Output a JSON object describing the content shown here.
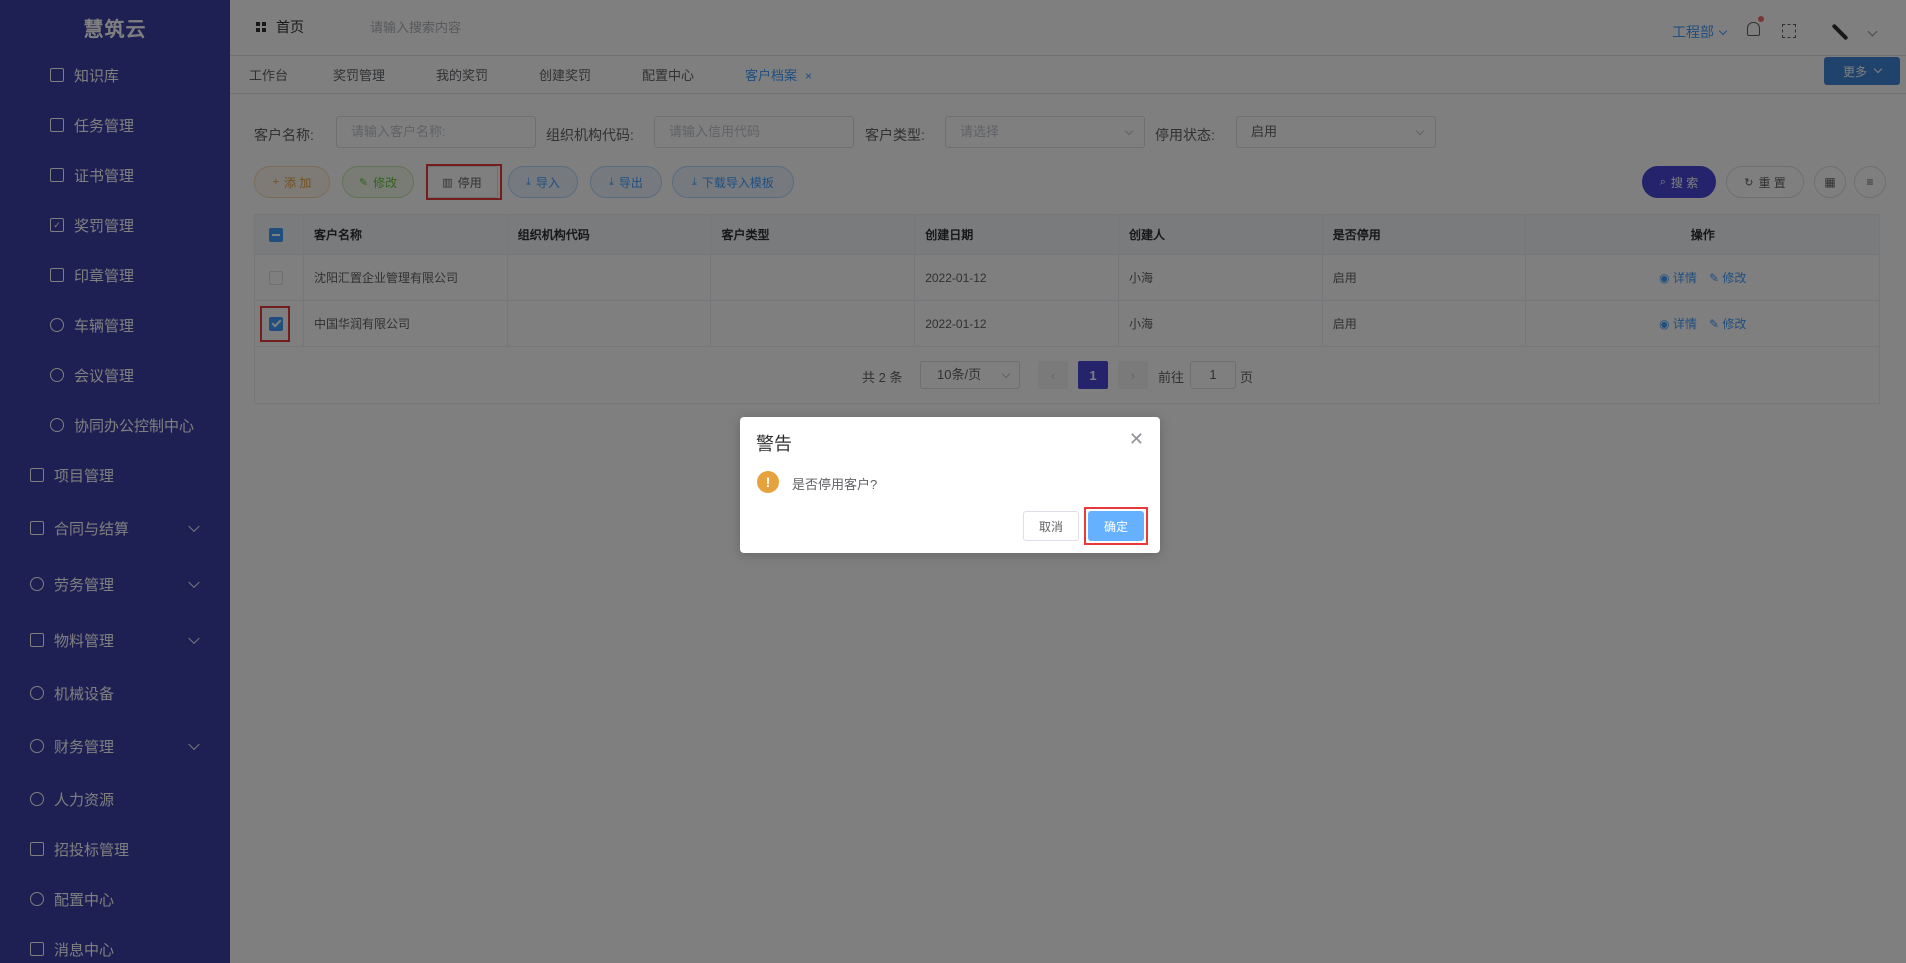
{
  "app": {
    "name": "慧筑云"
  },
  "sidebar": {
    "items": [
      {
        "label": "知识库",
        "icon": "book-icon"
      },
      {
        "label": "任务管理",
        "icon": "org-chart-icon"
      },
      {
        "label": "证书管理",
        "icon": "certificate-icon"
      },
      {
        "label": "奖罚管理",
        "icon": "checkbox-icon"
      },
      {
        "label": "印章管理",
        "icon": "grid-icon"
      },
      {
        "label": "车辆管理",
        "icon": "location-icon"
      },
      {
        "label": "会议管理",
        "icon": "phone-icon"
      },
      {
        "label": "协同办公控制中心",
        "icon": "gear-icon"
      },
      {
        "label": "项目管理",
        "icon": "book-icon"
      },
      {
        "label": "合同与结算",
        "icon": "edit-icon"
      },
      {
        "label": "劳务管理",
        "icon": "user-icon"
      },
      {
        "label": "物料管理",
        "icon": "edit-icon"
      },
      {
        "label": "机械设备",
        "icon": "close-circle-icon"
      },
      {
        "label": "财务管理",
        "icon": "phone-icon"
      },
      {
        "label": "人力资源",
        "icon": "phone-icon"
      },
      {
        "label": "招投标管理",
        "icon": "link-icon"
      },
      {
        "label": "配置中心",
        "icon": "gear-icon"
      },
      {
        "label": "消息中心",
        "icon": "message-icon"
      }
    ]
  },
  "topbar": {
    "home": "首页",
    "search_placeholder": "请输入搜索内容",
    "department": "工程部"
  },
  "tabs": {
    "items": [
      "工作台",
      "奖罚管理",
      "我的奖罚",
      "创建奖罚",
      "配置中心",
      "客户档案"
    ],
    "active": "客户档案",
    "close": "×",
    "more": "更多"
  },
  "filters": {
    "name_label": "客户名称:",
    "name_placeholder": "请输入客户名称:",
    "code_label": "组织机构代码:",
    "code_placeholder": "请输入信用代码",
    "type_label": "客户类型:",
    "type_placeholder": "请选择",
    "status_label": "停用状态:",
    "status_value": "启用"
  },
  "toolbar": {
    "add": "添 加",
    "edit": "修改",
    "stop": "停用",
    "import": "导入",
    "export": "导出",
    "template": "下载导入模板",
    "search": "搜 索",
    "reset": "重 置"
  },
  "table": {
    "headers": [
      "客户名称",
      "组织机构代码",
      "客户类型",
      "创建日期",
      "创建人",
      "是否停用",
      "操作"
    ],
    "rows": [
      {
        "name": "沈阳汇置企业管理有限公司",
        "code": "",
        "type": "",
        "date": "2022-01-12",
        "creator": "小海",
        "status": "启用",
        "checked": false
      },
      {
        "name": "中国华润有限公司",
        "code": "",
        "type": "",
        "date": "2022-01-12",
        "creator": "小海",
        "status": "启用",
        "checked": true
      }
    ],
    "ops": {
      "detail": "详情",
      "edit": "修改"
    }
  },
  "pagination": {
    "total": "共 2 条",
    "page_size": "10条/页",
    "current": "1",
    "goto_label": "前往",
    "goto_value": "1",
    "page_suffix": "页"
  },
  "dialog": {
    "title": "警告",
    "message": "是否停用客户?",
    "cancel": "取消",
    "confirm": "确定"
  },
  "colors": {
    "sidebar": "#3d3fa6",
    "primary": "#4847d6",
    "link": "#409eff",
    "warning": "#e6a23c",
    "highlight": "#e73b3b"
  }
}
